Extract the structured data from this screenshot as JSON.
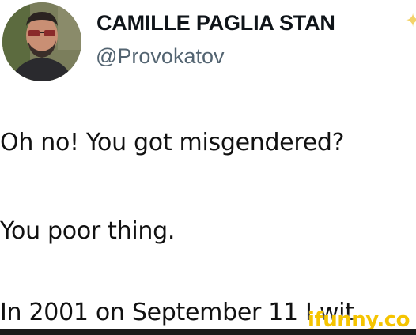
{
  "tweet": {
    "display_name": "CAMILLE PAGLIA STAN",
    "handle": "@Provokatov",
    "lines": [
      "Oh no! You got misgendered?",
      "You poor thing.",
      "In 2001 on September 11 I wit"
    ]
  },
  "watermark": "ifunny.co",
  "icons": {
    "avatar": "avatar-photo",
    "badge": "sparkle-icon"
  },
  "colors": {
    "watermark": "#f5c400",
    "handle": "#536471"
  }
}
